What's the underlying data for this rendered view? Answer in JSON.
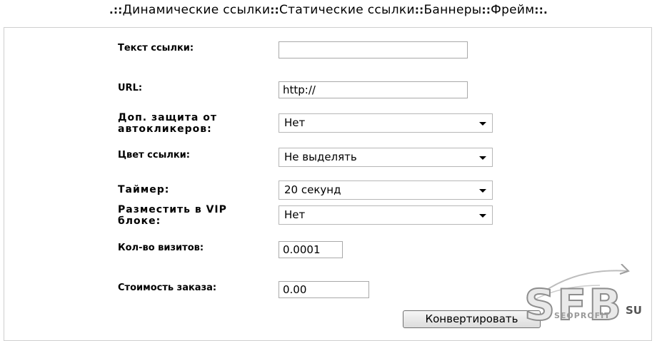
{
  "nav": {
    "prefix": ".::",
    "items": [
      "Динамические ссылки",
      "Статические ссылки",
      "Баннеры",
      "Фрейм"
    ],
    "separator": "::",
    "suffix": "::."
  },
  "form": {
    "link_text_label": "Текст ссылки:",
    "link_text_value": "",
    "url_label": "URL:",
    "url_value": "http://",
    "protection_label_line1": "Доп. защита от",
    "protection_label_line2": "автокликеров:",
    "protection_value": "Нет",
    "color_label": "Цвет ссылки:",
    "color_value": "Не выделять",
    "timer_label": "Таймер:",
    "timer_value": "20 секунд",
    "vip_label_line1": "Разместить в VIP",
    "vip_label_line2": "блоке:",
    "vip_value": "Нет",
    "visits_label": "Кол-во визитов:",
    "visits_value": "0.0001",
    "cost_label": "Стоимость заказа:",
    "cost_value": "0.00",
    "convert_button": "Конвертировать"
  },
  "watermark": {
    "main": "SFB",
    "sub": "SEOPROFIT",
    "domain": "SU"
  }
}
